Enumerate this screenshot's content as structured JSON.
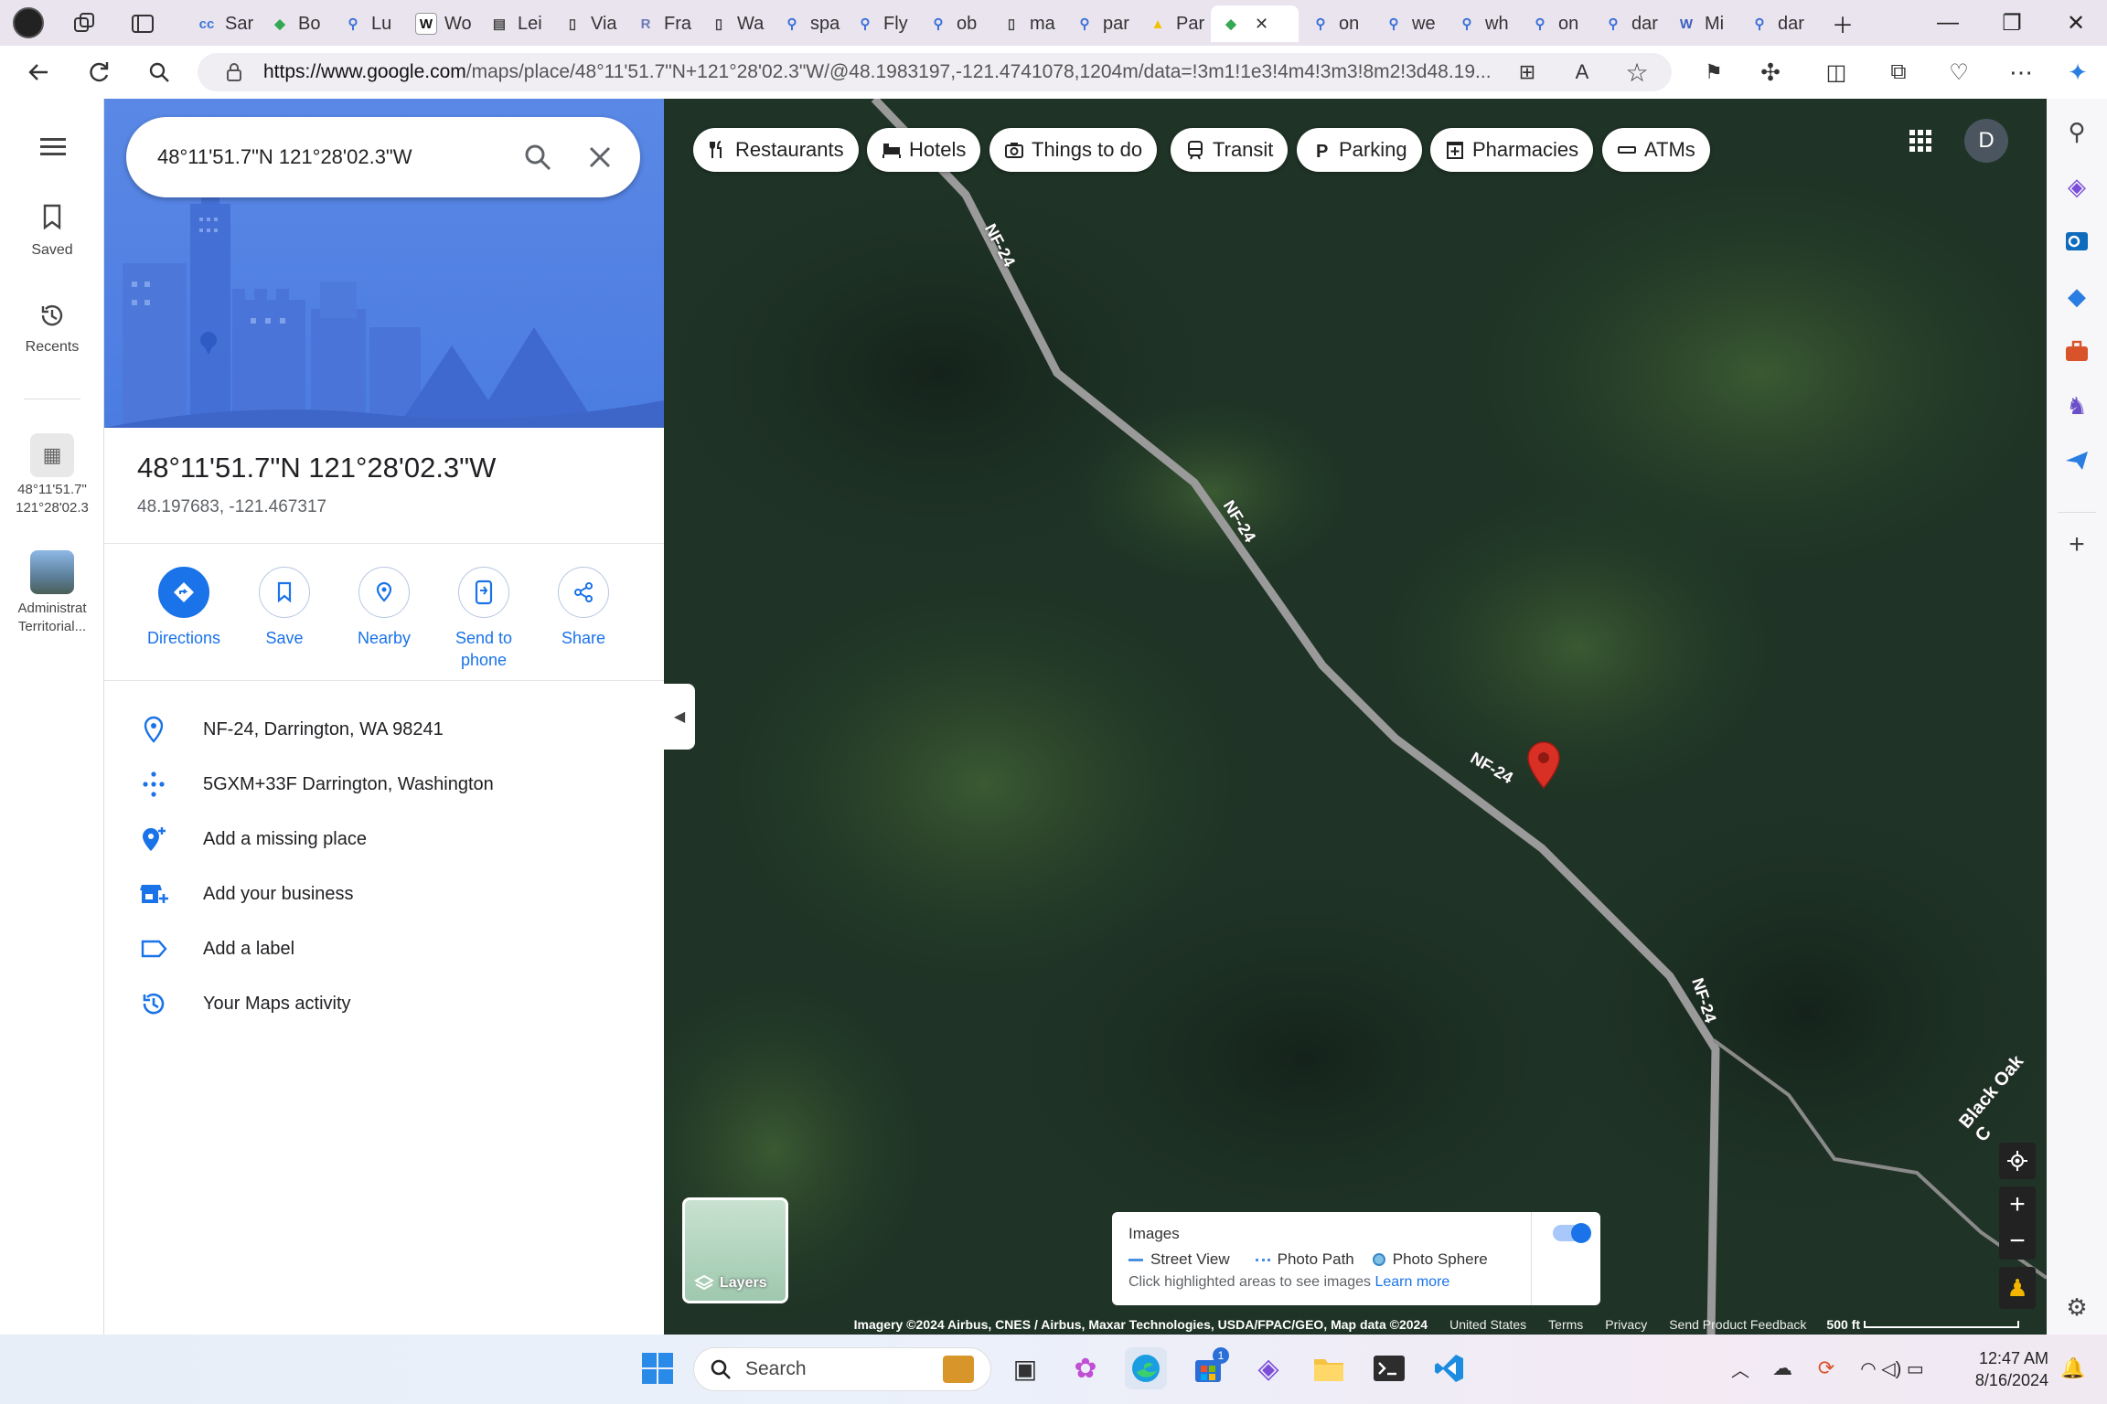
{
  "browser": {
    "tabs": [
      {
        "label": "Sar",
        "icon": "cc-icon",
        "color": "#3a78d8",
        "glyph": "cc"
      },
      {
        "label": "Bo",
        "icon": "maps-pin-icon",
        "color": "#34a853",
        "glyph": "◆"
      },
      {
        "label": "Lu",
        "icon": "search-icon",
        "color": "#3a6fd8",
        "glyph": "⚲"
      },
      {
        "label": "Wo",
        "icon": "wikipedia-icon",
        "color": "#ffffff",
        "glyph": "W"
      },
      {
        "label": "Lei",
        "icon": "page-icon",
        "color": "#444",
        "glyph": "▤"
      },
      {
        "label": "Via",
        "icon": "document-icon",
        "color": "#444",
        "glyph": "▯"
      },
      {
        "label": "Fra",
        "icon": "r-icon",
        "color": "#6b7bb8",
        "glyph": "R"
      },
      {
        "label": "Wa",
        "icon": "document-icon",
        "color": "#444",
        "glyph": "▯"
      },
      {
        "label": "spa",
        "icon": "search-icon",
        "color": "#3a6fd8",
        "glyph": "⚲"
      },
      {
        "label": "Fly",
        "icon": "search-icon",
        "color": "#3a6fd8",
        "glyph": "⚲"
      },
      {
        "label": "ob",
        "icon": "search-icon",
        "color": "#3a6fd8",
        "glyph": "⚲"
      },
      {
        "label": "ma",
        "icon": "document-icon",
        "color": "#444",
        "glyph": "▯"
      },
      {
        "label": "par",
        "icon": "search-icon",
        "color": "#3a6fd8",
        "glyph": "⚲"
      },
      {
        "label": "Par",
        "icon": "warning-icon",
        "color": "#f2c200",
        "glyph": "▲"
      },
      {
        "label": "",
        "icon": "maps-pin-icon",
        "color": "#34a853",
        "glyph": "◆",
        "active": true
      },
      {
        "label": "on",
        "icon": "search-icon",
        "color": "#3a6fd8",
        "glyph": "⚲"
      },
      {
        "label": "we",
        "icon": "search-icon",
        "color": "#3a6fd8",
        "glyph": "⚲"
      },
      {
        "label": "wh",
        "icon": "search-icon",
        "color": "#3a6fd8",
        "glyph": "⚲"
      },
      {
        "label": "on",
        "icon": "search-icon",
        "color": "#3a6fd8",
        "glyph": "⚲"
      },
      {
        "label": "dar",
        "icon": "search-icon",
        "color": "#3a6fd8",
        "glyph": "⚲"
      },
      {
        "label": "Mi",
        "icon": "wordpress-icon",
        "color": "#3a5fbf",
        "glyph": "W"
      },
      {
        "label": "dar",
        "icon": "search-icon",
        "color": "#3a6fd8",
        "glyph": "⚲"
      }
    ],
    "url_host": "https://www.google.com",
    "url_path": "/maps/place/48°11'51.7\"N+121°28'02.3\"W/@48.1983197,-121.4741078,1204m/data=!3m1!1e3!4m4!3m3!8m2!3d48.19..."
  },
  "rail": {
    "saved": "Saved",
    "recents": "Recents",
    "recent1": "48°11'51.7\" 121°28'02.3",
    "recent2": "Administrat Territorial..."
  },
  "panel": {
    "search_value": "48°11'51.7\"N 121°28'02.3\"W",
    "title": "48°11'51.7\"N 121°28'02.3\"W",
    "coords": "48.197683, -121.467317",
    "actions": {
      "directions": "Directions",
      "save": "Save",
      "nearby": "Nearby",
      "send": "Send to phone",
      "share": "Share"
    },
    "rows": {
      "address": "NF-24, Darrington, WA 98241",
      "plus_code": "5GXM+33F Darrington, Washington",
      "missing": "Add a missing place",
      "business": "Add your business",
      "label": "Add a label",
      "activity": "Your Maps activity"
    }
  },
  "map": {
    "chips": [
      "Restaurants",
      "Hotels",
      "Things to do",
      "Transit",
      "Parking",
      "Pharmacies",
      "ATMs"
    ],
    "account_initial": "D",
    "road_label": "NF-24",
    "road2_label": "Black Oak C",
    "layers": "Layers",
    "images": {
      "title": "Images",
      "street_view": "Street View",
      "photo_path": "Photo Path",
      "photo_sphere": "Photo Sphere",
      "hint": "Click highlighted areas to see images",
      "learn_more": "Learn more"
    },
    "attribution": "Imagery ©2024 Airbus, CNES / Airbus, Maxar Technologies, USDA/FPAC/GEO, Map data ©2024",
    "footer": {
      "country": "United States",
      "terms": "Terms",
      "privacy": "Privacy",
      "feedback": "Send Product Feedback",
      "scale": "500 ft"
    }
  },
  "taskbar": {
    "search": "Search",
    "time": "12:47 AM",
    "date": "8/16/2024",
    "store_badge": "1"
  },
  "colors": {
    "accent": "#1a73e8",
    "pin": "#d93025",
    "map_bg": "#1e3224"
  }
}
